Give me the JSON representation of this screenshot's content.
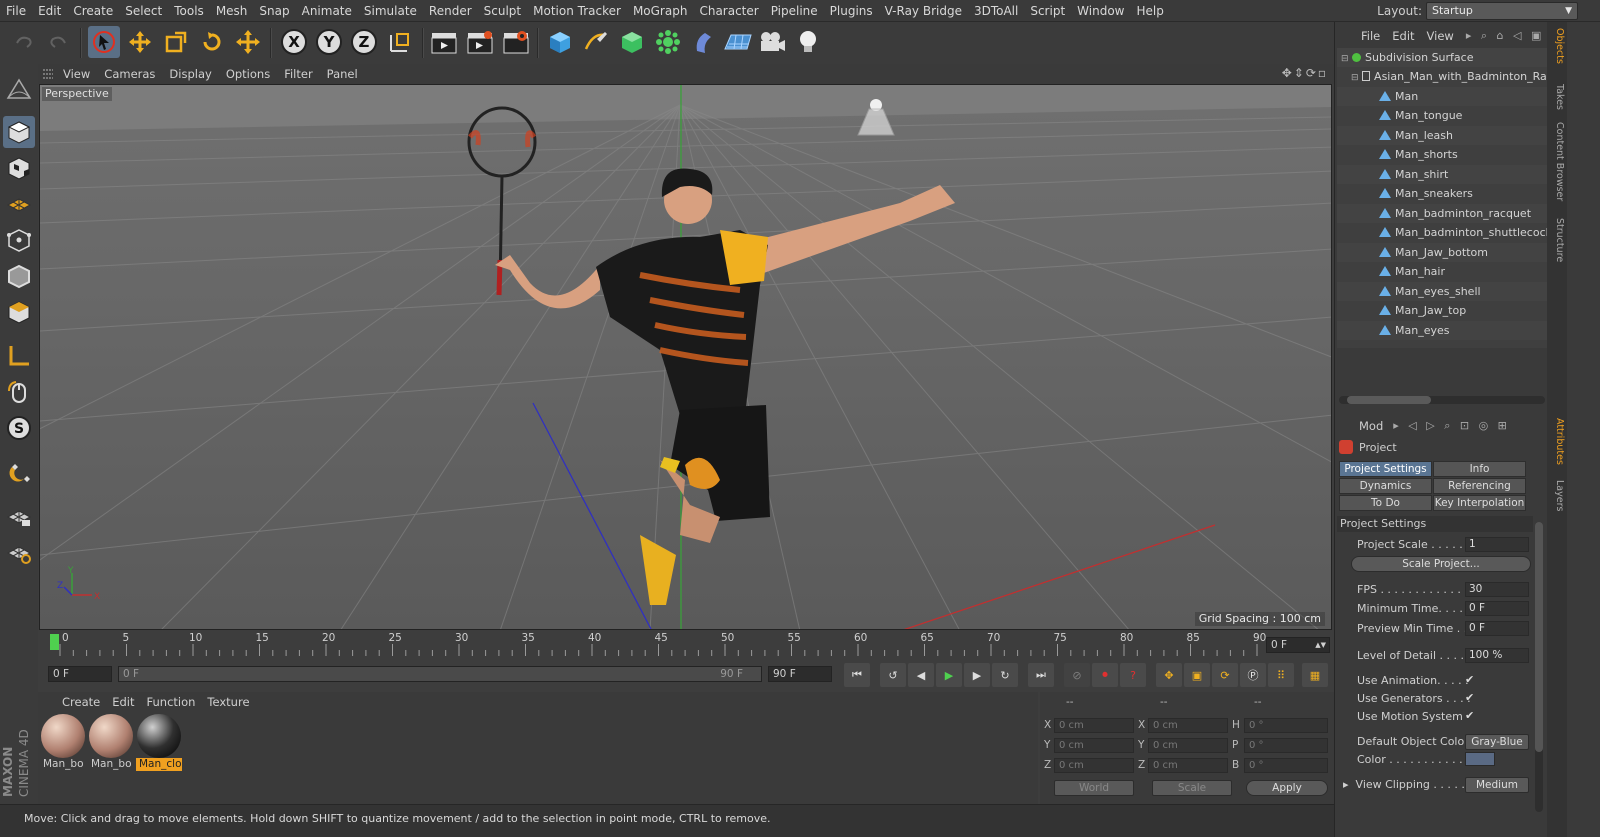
{
  "menubar": [
    "File",
    "Edit",
    "Create",
    "Select",
    "Tools",
    "Mesh",
    "Snap",
    "Animate",
    "Simulate",
    "Render",
    "Sculpt",
    "Motion Tracker",
    "MoGraph",
    "Character",
    "Pipeline",
    "Plugins",
    "V-Ray Bridge",
    "3DToAll",
    "Script",
    "Window",
    "Help"
  ],
  "layout": {
    "label": "Layout:",
    "value": "Startup"
  },
  "viewport": {
    "menu": [
      "View",
      "Cameras",
      "Display",
      "Options",
      "Filter",
      "Panel"
    ],
    "label": "Perspective",
    "grid_spacing": "Grid Spacing : 100 cm"
  },
  "timeline": {
    "ticks": [
      "0",
      "5",
      "10",
      "15",
      "20",
      "25",
      "30",
      "35",
      "40",
      "45",
      "50",
      "55",
      "60",
      "65",
      "70",
      "75",
      "80",
      "85",
      "90"
    ],
    "current_frame": "0 F",
    "start": "0 F",
    "range_start": "0 F",
    "range_end": "90 F",
    "end": "90 F"
  },
  "materials": {
    "menu": [
      "Create",
      "Edit",
      "Function",
      "Texture"
    ],
    "items": [
      {
        "label": "Man_bo"
      },
      {
        "label": "Man_bo"
      },
      {
        "label": "Man_clo"
      }
    ]
  },
  "coordinates": {
    "header": [
      "--",
      "--",
      "--"
    ],
    "rows": [
      {
        "a": "X",
        "av": "0 cm",
        "b": "X",
        "bv": "0 cm",
        "c": "H",
        "cv": "0 °"
      },
      {
        "a": "Y",
        "av": "0 cm",
        "b": "Y",
        "bv": "0 cm",
        "c": "P",
        "cv": "0 °"
      },
      {
        "a": "Z",
        "av": "0 cm",
        "b": "Z",
        "bv": "0 cm",
        "c": "B",
        "cv": "0 °"
      }
    ],
    "world": "World",
    "scale": "Scale",
    "apply": "Apply"
  },
  "status": "Move: Click and drag to move elements. Hold down SHIFT to quantize movement / add to the selection in point mode, CTRL to remove.",
  "brand": {
    "line1": "MAXON",
    "line2": "CINEMA 4D"
  },
  "objects": {
    "menu": [
      "File",
      "Edit",
      "View"
    ],
    "items": [
      "Subdivision Surface",
      "Asian_Man_with_Badminton_Racquet",
      "Man",
      "Man_tongue",
      "Man_leash",
      "Man_shorts",
      "Man_shirt",
      "Man_sneakers",
      "Man_badminton_racquet",
      "Man_badminton_shuttlecock",
      "Man_Jaw_bottom",
      "Man_hair",
      "Man_eyes_shell",
      "Man_Jaw_top",
      "Man_eyes"
    ]
  },
  "side_tabs": [
    "Objects",
    "Takes",
    "Content Browser",
    "Structure",
    "Attributes",
    "Layers"
  ],
  "attributes": {
    "mode": "Mod",
    "title": "Project",
    "tabs": [
      "Project Settings",
      "Info",
      "Dynamics",
      "Referencing",
      "To Do",
      "Key Interpolation"
    ],
    "section": "Project Settings",
    "project_scale": {
      "label": "Project Scale . . . . . .",
      "value": "1"
    },
    "scale_button": "Scale Project...",
    "fps": {
      "label": "FPS . . . . . . . . . . . . . .",
      "value": "30"
    },
    "min_time": {
      "label": "Minimum Time. . . . .",
      "value": "0 F"
    },
    "preview_min": {
      "label": "Preview Min Time . .",
      "value": "0 F"
    },
    "lod": {
      "label": "Level of Detail . . . . .",
      "value": "100 %"
    },
    "use_anim": {
      "label": "Use Animation. . . . .",
      "value": "✔"
    },
    "use_gen": {
      "label": "Use Generators . . . .",
      "value": "✔"
    },
    "use_motion": {
      "label": "Use Motion System",
      "value": "✔"
    },
    "default_color": {
      "label": "Default Object Color",
      "value": "Gray-Blue"
    },
    "color": {
      "label": "Color . . . . . . . . . . . ."
    },
    "view_clip": {
      "label": "View Clipping . . . . .",
      "value": "Medium"
    }
  },
  "colors": {
    "accent": "#5a7593",
    "timeline_marker": "#4fd04f",
    "selected_material": "#f0a020"
  }
}
